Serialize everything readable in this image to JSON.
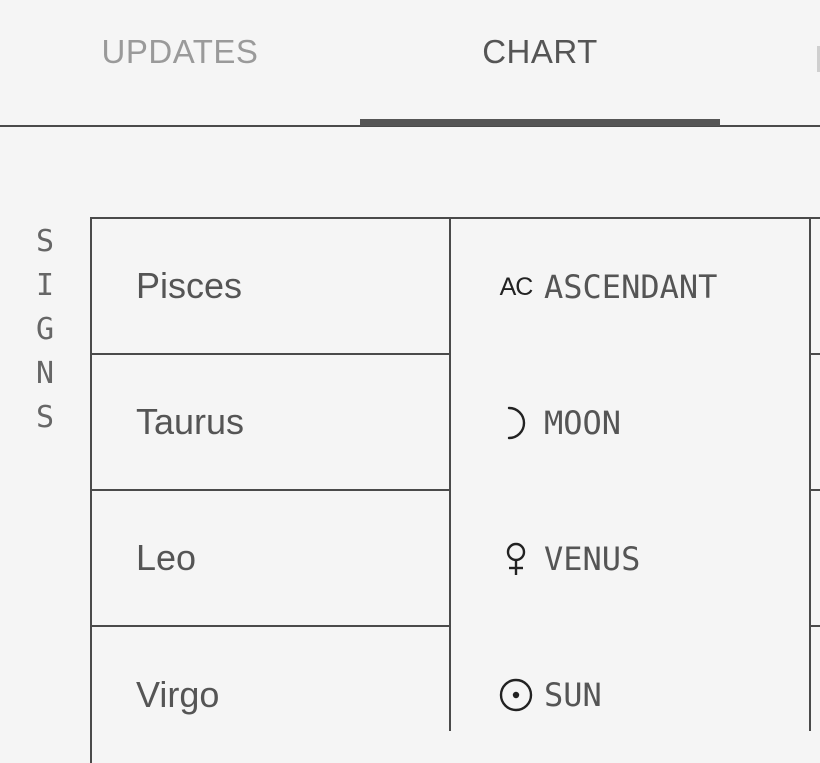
{
  "tabs": {
    "updates_label": "UPDATES",
    "chart_label": "CHART",
    "active": "CHART"
  },
  "side_label": [
    "S",
    "I",
    "G",
    "N",
    "S"
  ],
  "signs": [
    "Pisces",
    "Taurus",
    "Leo",
    "Virgo"
  ],
  "placements": [
    {
      "icon": "ascendant-icon",
      "glyph": "AC",
      "label": "ASCENDANT"
    },
    {
      "icon": "moon-icon",
      "label": "MOON"
    },
    {
      "icon": "venus-icon",
      "label": "VENUS"
    },
    {
      "icon": "sun-icon",
      "label": "SUN"
    }
  ],
  "colors": {
    "background": "#f5f5f5",
    "text": "#555555",
    "inactive_tab": "#9a9a9a",
    "lines": "#4a4a4a",
    "icon": "#222222"
  }
}
